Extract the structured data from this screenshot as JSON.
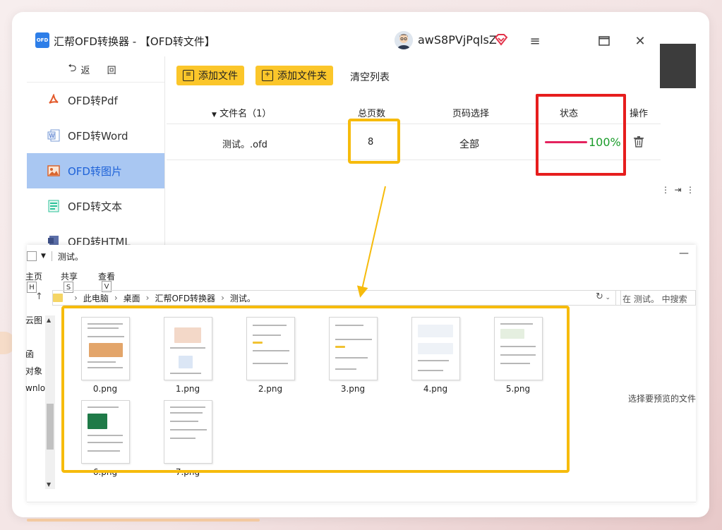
{
  "window": {
    "logo": "OFD",
    "title": "汇帮OFD转换器 - 【OFD转文件】",
    "username": "awS8PVjPqlsZ"
  },
  "sidebar": {
    "back_label": "返 回",
    "items": [
      {
        "label": "OFD转Pdf",
        "icon": "pdf-icon",
        "active": false
      },
      {
        "label": "OFD转Word",
        "icon": "word-icon",
        "active": false
      },
      {
        "label": "OFD转图片",
        "icon": "image-icon",
        "active": true
      },
      {
        "label": "OFD转文本",
        "icon": "text-icon",
        "active": false
      },
      {
        "label": "OFD转HTML",
        "icon": "html-icon",
        "active": false
      }
    ]
  },
  "toolbar": {
    "add_file": "添加文件",
    "add_folder": "添加文件夹",
    "clear_list": "清空列表"
  },
  "table": {
    "headers": {
      "filename": "文件名（1）",
      "pages": "总页数",
      "page_select": "页码选择",
      "status": "状态",
      "action": "操作"
    },
    "rows": [
      {
        "filename": "测试。.ofd",
        "pages": "8",
        "page_select": "全部",
        "progress": 1.0,
        "progress_text": "100%"
      }
    ]
  },
  "explorer": {
    "title": "测试。",
    "ribbon": {
      "home": "主页",
      "share": "共享",
      "view": "查看",
      "key_home": "H",
      "key_share": "S",
      "key_view": "V"
    },
    "breadcrumb": [
      "此电脑",
      "桌面",
      "汇帮OFD转换器",
      "测试。"
    ],
    "search_placeholder": "在 测试。 中搜索",
    "left_items": [
      "云图",
      "",
      "函",
      "对象",
      "wnloa",
      "",
      "",
      "",
      "",
      ""
    ],
    "files": [
      "0.png",
      "1.png",
      "2.png",
      "3.png",
      "4.png",
      "5.png",
      "6.png",
      "7.png"
    ],
    "preview_hint": "选择要预览的文件"
  },
  "colors": {
    "accent_yellow": "#fbc62a",
    "highlight_yellow": "#f6bb0c",
    "highlight_red": "#e61d1d",
    "active_nav_bg": "#a9c7f2",
    "active_nav_text": "#1e62d8",
    "progress": "#e4235e",
    "success": "#1a9c2a"
  }
}
